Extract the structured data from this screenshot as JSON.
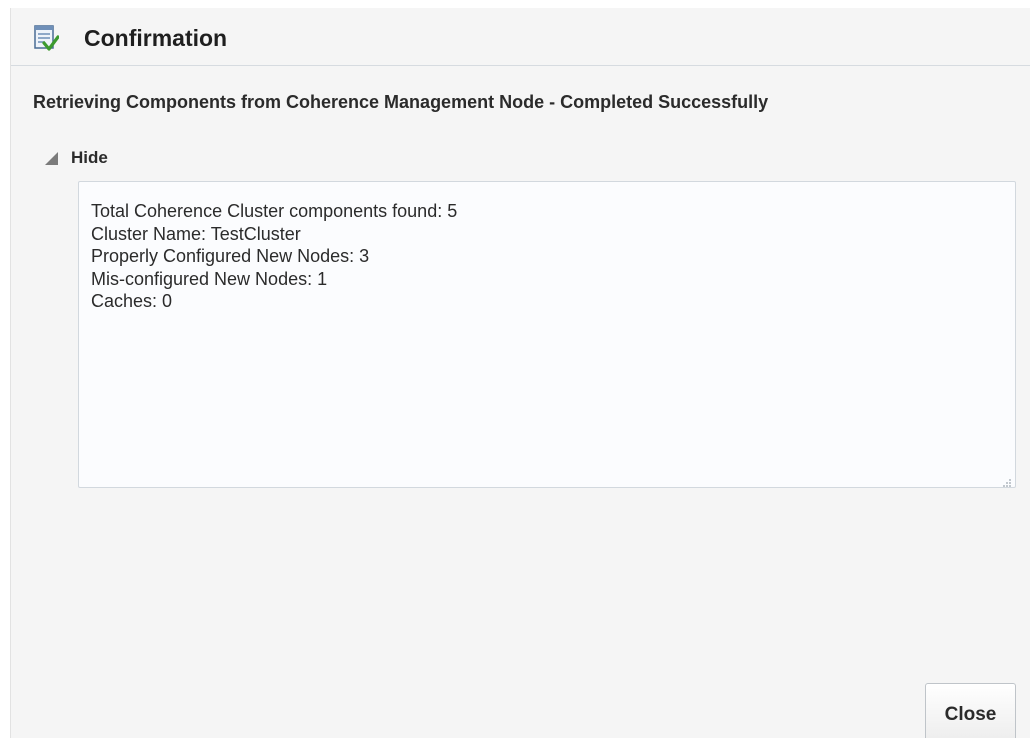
{
  "dialog": {
    "title": "Confirmation",
    "title_icon": "confirmation-checklist-icon"
  },
  "status": {
    "message": "Retrieving Components from Coherence Management Node - Completed Successfully"
  },
  "details_toggle": {
    "label": "Hide",
    "icon": "disclosure-triangle-expanded-icon"
  },
  "details": {
    "lines": [
      "Total Coherence Cluster components found: 5",
      "Cluster Name: TestCluster",
      "Properly Configured New Nodes: 3",
      "Mis-configured New Nodes: 1",
      "Caches: 0"
    ]
  },
  "footer": {
    "close_label": "Close"
  },
  "colors": {
    "dialog_background": "#f5f5f5",
    "text": "#2b2b2b",
    "details_background": "#fbfcfe",
    "icon_check": "#3c9a2e"
  }
}
